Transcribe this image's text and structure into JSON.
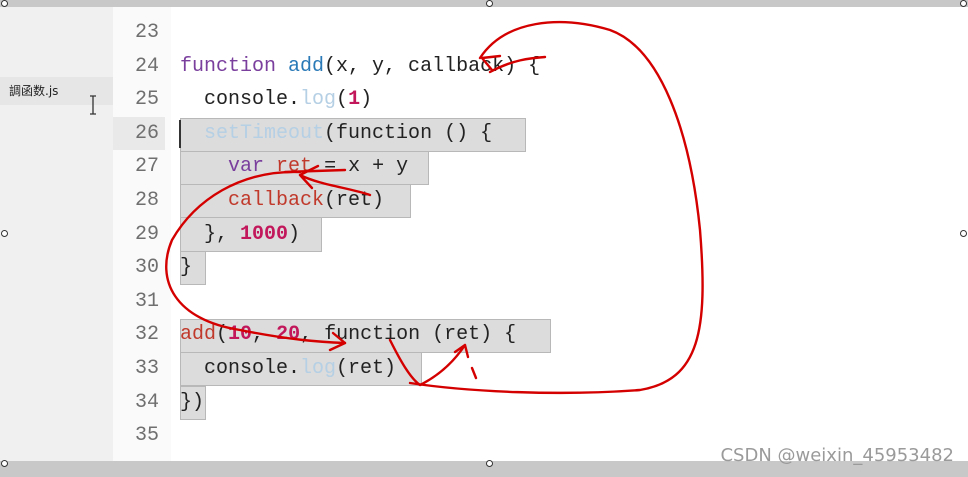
{
  "sidebar": {
    "file_name": "調函数.js"
  },
  "editor": {
    "line_numbers": [
      "23",
      "24",
      "25",
      "26",
      "27",
      "28",
      "29",
      "30",
      "31",
      "32",
      "33",
      "34",
      "35"
    ],
    "current_line": "26",
    "lines": [
      {
        "tokens": []
      },
      {
        "tokens": [
          {
            "t": "function",
            "c": "kw"
          },
          {
            "t": " ",
            "c": "plain"
          },
          {
            "t": "add",
            "c": "fn"
          },
          {
            "t": "(x, y, callback) {",
            "c": "plain"
          }
        ]
      },
      {
        "tokens": [
          {
            "t": "  console.",
            "c": "plain"
          },
          {
            "t": "log",
            "c": "faded"
          },
          {
            "t": "(",
            "c": "plain"
          },
          {
            "t": "1",
            "c": "num"
          },
          {
            "t": ")",
            "c": "plain"
          }
        ]
      },
      {
        "tokens": [
          {
            "t": "  ",
            "c": "plain"
          },
          {
            "t": "setTimeout",
            "c": "faded"
          },
          {
            "t": "(function () {",
            "c": "plain"
          }
        ]
      },
      {
        "tokens": [
          {
            "t": "    ",
            "c": "plain"
          },
          {
            "t": "var",
            "c": "kw"
          },
          {
            "t": " ",
            "c": "plain"
          },
          {
            "t": "ret",
            "c": "var"
          },
          {
            "t": " = x + y",
            "c": "plain"
          }
        ]
      },
      {
        "tokens": [
          {
            "t": "    ",
            "c": "plain"
          },
          {
            "t": "callback",
            "c": "var"
          },
          {
            "t": "(ret)",
            "c": "plain"
          }
        ]
      },
      {
        "tokens": [
          {
            "t": "  }, ",
            "c": "plain"
          },
          {
            "t": "1000",
            "c": "num"
          },
          {
            "t": ")",
            "c": "plain"
          }
        ]
      },
      {
        "tokens": [
          {
            "t": "}",
            "c": "plain"
          }
        ]
      },
      {
        "tokens": []
      },
      {
        "tokens": [
          {
            "t": "add",
            "c": "var"
          },
          {
            "t": "(",
            "c": "plain"
          },
          {
            "t": "10",
            "c": "num"
          },
          {
            "t": ", ",
            "c": "plain"
          },
          {
            "t": "20",
            "c": "num"
          },
          {
            "t": ", function (ret) {",
            "c": "plain"
          }
        ]
      },
      {
        "tokens": [
          {
            "t": "  console.",
            "c": "plain"
          },
          {
            "t": "log",
            "c": "faded"
          },
          {
            "t": "(ret)",
            "c": "plain"
          }
        ]
      },
      {
        "tokens": [
          {
            "t": "})",
            "c": "plain"
          }
        ]
      },
      {
        "tokens": []
      }
    ]
  },
  "watermark": "CSDN @weixin_45953482",
  "colors": {
    "annotation_ink": "#d40000",
    "selection": "#dcdcdc"
  }
}
